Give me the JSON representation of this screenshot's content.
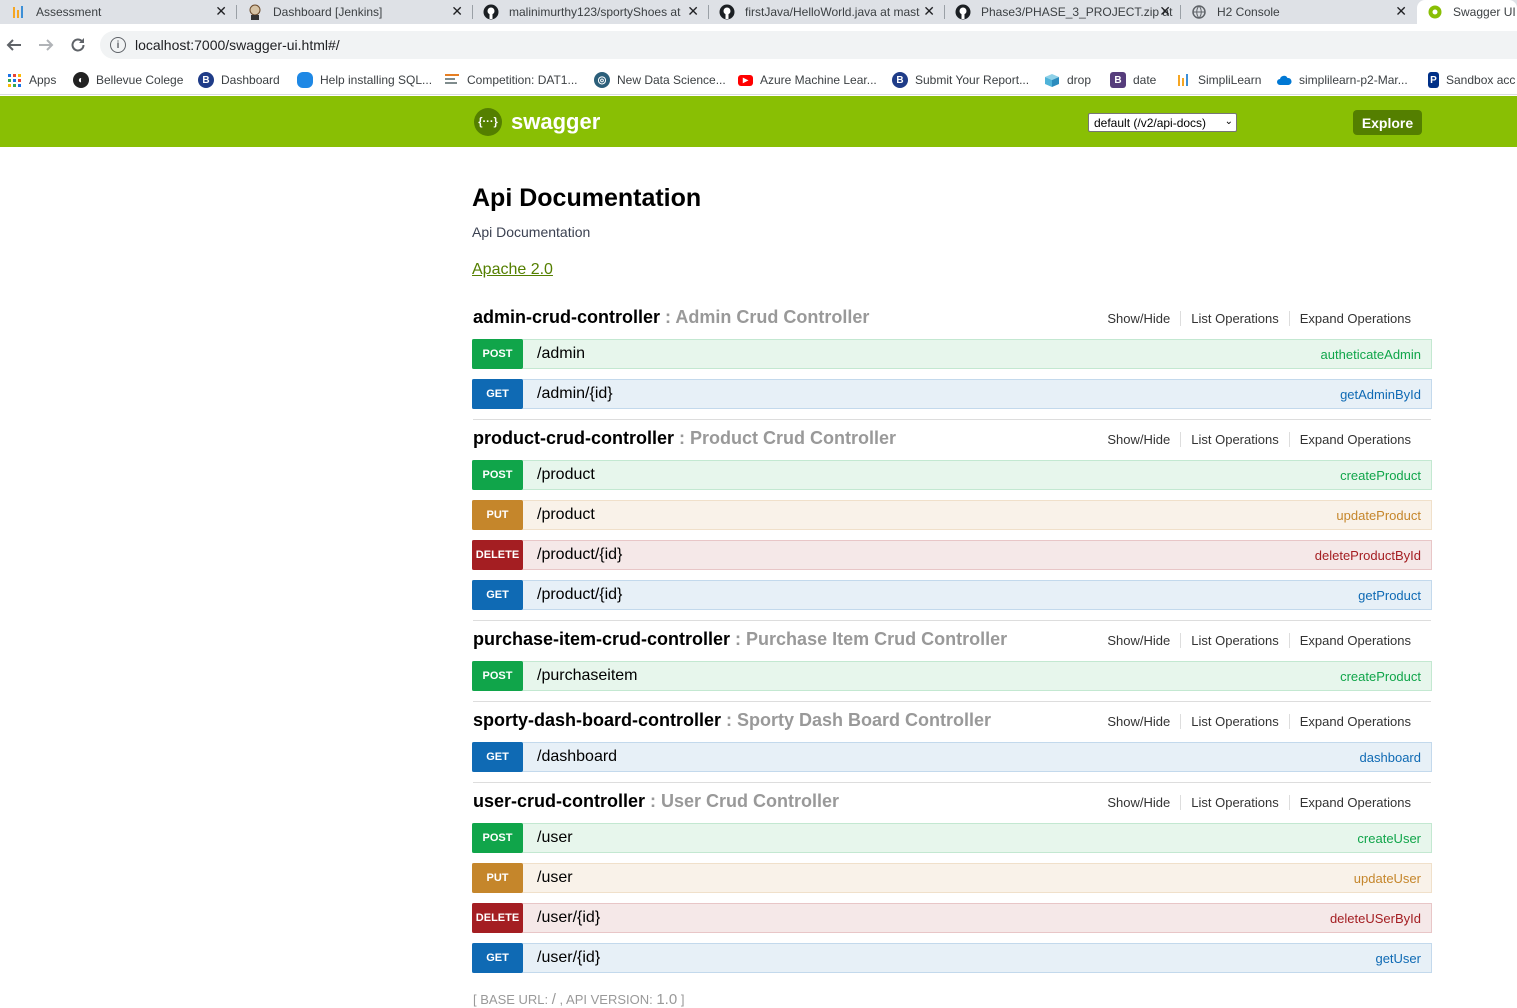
{
  "browser": {
    "tabs": [
      {
        "title": "Assessment",
        "icon": "simplilearn-icon"
      },
      {
        "title": "Dashboard [Jenkins]",
        "icon": "jenkins-icon"
      },
      {
        "title": "malinimurthy123/sportyShoes at",
        "icon": "github-icon"
      },
      {
        "title": "firstJava/HelloWorld.java at mast",
        "icon": "github-icon"
      },
      {
        "title": "Phase3/PHASE_3_PROJECT.zip at",
        "icon": "github-icon"
      },
      {
        "title": "H2 Console",
        "icon": "globe-icon"
      },
      {
        "title": "Swagger UI",
        "icon": "swagger-icon"
      }
    ],
    "url": "localhost:7000/swagger-ui.html#/",
    "bookmarks": [
      {
        "label": "Apps"
      },
      {
        "label": "Bellevue Colege"
      },
      {
        "label": "Dashboard"
      },
      {
        "label": "Help installing SQL..."
      },
      {
        "label": "Competition: DAT1..."
      },
      {
        "label": "New Data Science..."
      },
      {
        "label": "Azure Machine Lear..."
      },
      {
        "label": "Submit Your Report..."
      },
      {
        "label": "drop"
      },
      {
        "label": "date"
      },
      {
        "label": "SimpliLearn"
      },
      {
        "label": "simplilearn-p2-Mar..."
      },
      {
        "label": "Sandbox acc"
      }
    ]
  },
  "swagger": {
    "logo_text": "swagger",
    "spec_select": "default (/v2/api-docs)",
    "explore_label": "Explore",
    "brand_color": "#89bf04"
  },
  "info": {
    "title": "Api Documentation",
    "description": "Api Documentation",
    "license": "Apache 2.0"
  },
  "header_links": {
    "show_hide": "Show/Hide",
    "list_ops": "List Operations",
    "expand_ops": "Expand Operations"
  },
  "controllers": [
    {
      "name": "admin-crud-controller",
      "description": " : Admin Crud Controller",
      "operations": [
        {
          "method": "POST",
          "path": "/admin",
          "nickname": "autheticateAdmin"
        },
        {
          "method": "GET",
          "path": "/admin/{id}",
          "nickname": "getAdminById"
        }
      ]
    },
    {
      "name": "product-crud-controller",
      "description": " : Product Crud Controller",
      "operations": [
        {
          "method": "POST",
          "path": "/product",
          "nickname": "createProduct"
        },
        {
          "method": "PUT",
          "path": "/product",
          "nickname": "updateProduct"
        },
        {
          "method": "DELETE",
          "path": "/product/{id}",
          "nickname": "deleteProductById"
        },
        {
          "method": "GET",
          "path": "/product/{id}",
          "nickname": "getProduct"
        }
      ]
    },
    {
      "name": "purchase-item-crud-controller",
      "description": " : Purchase Item Crud Controller",
      "operations": [
        {
          "method": "POST",
          "path": "/purchaseitem",
          "nickname": "createProduct"
        }
      ]
    },
    {
      "name": "sporty-dash-board-controller",
      "description": " : Sporty Dash Board Controller",
      "operations": [
        {
          "method": "GET",
          "path": "/dashboard",
          "nickname": "dashboard"
        }
      ]
    },
    {
      "name": "user-crud-controller",
      "description": " : User Crud Controller",
      "operations": [
        {
          "method": "POST",
          "path": "/user",
          "nickname": "createUser"
        },
        {
          "method": "PUT",
          "path": "/user",
          "nickname": "updateUser"
        },
        {
          "method": "DELETE",
          "path": "/user/{id}",
          "nickname": "deleteUSerById"
        },
        {
          "method": "GET",
          "path": "/user/{id}",
          "nickname": "getUser"
        }
      ]
    }
  ],
  "footer": {
    "base_url_label": "[ BASE URL: ",
    "base_url": "/",
    "api_version_label": " , API VERSION: ",
    "api_version": "1.0",
    "close": " ]"
  }
}
